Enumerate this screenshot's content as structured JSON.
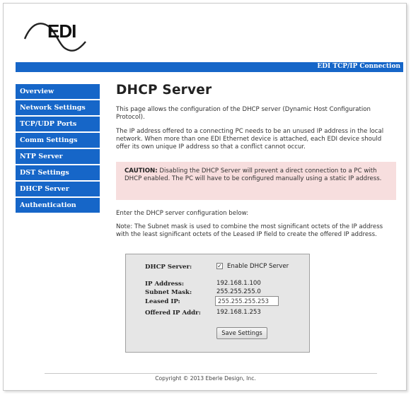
{
  "header": {
    "logo_text": "EDI",
    "topbar_title": "EDI TCP/IP Connection"
  },
  "sidebar": {
    "items": [
      {
        "label": "Overview"
      },
      {
        "label": "Network Settings"
      },
      {
        "label": "TCP/UDP Ports"
      },
      {
        "label": "Comm Settings"
      },
      {
        "label": "NTP Server"
      },
      {
        "label": "DST Settings"
      },
      {
        "label": "DHCP Server"
      },
      {
        "label": "Authentication"
      }
    ]
  },
  "main": {
    "title": "DHCP Server",
    "intro": "This page allows the configuration of the DHCP server (Dynamic Host Configuration Protocol).",
    "info": "The IP address offered to a connecting PC needs to be an unused IP address in the local network. When more than one EDI Ethernet device is attached, each EDI device should offer its own unique IP address so that a conflict cannot occur.",
    "caution_label": "CAUTION:",
    "caution_text": " Disabling the DHCP Server will prevent a direct connection to a PC with DHCP enabled. The PC will have to be configured manually using a static IP address.",
    "enter_text": "Enter the DHCP server configuration below:",
    "note": "Note: The Subnet mask is used to combine the most significant octets of the IP address with the least significant octets of the Leased IP field to create the offered IP address."
  },
  "config": {
    "dhcp_label": "DHCP Server:",
    "enable_checked": true,
    "enable_label": "Enable DHCP Server",
    "ip_label": "IP Address:",
    "ip_value": "192.168.1.100",
    "subnet_label": "Subnet Mask:",
    "subnet_value": "255.255.255.0",
    "leased_label": "Leased IP:",
    "leased_value": "255.255.255.253",
    "offered_label": "Offered IP Addr:",
    "offered_value": "192.168.1.253",
    "save_label": "Save Settings",
    "check_glyph": "✓"
  },
  "footer": {
    "copyright": "Copyright © 2013 Eberle Design, Inc."
  },
  "colors": {
    "brand_blue": "#1666c8",
    "caution_bg": "#f7dede",
    "panel_bg": "#e6e6e6"
  }
}
